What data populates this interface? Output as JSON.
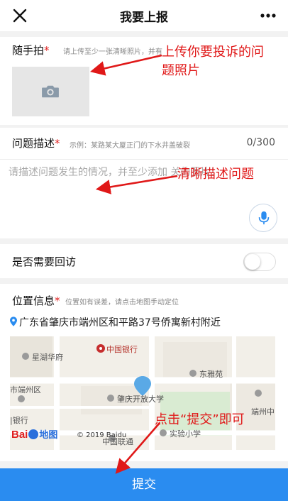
{
  "header": {
    "title": "我要上报",
    "close_icon": "close-icon",
    "more_icon": "more-icon"
  },
  "photo": {
    "label": "随手拍",
    "required_mark": "*",
    "hint": "请上传至少一张清晰照片，并有",
    "icon": "camera-icon"
  },
  "description": {
    "label": "问题描述",
    "required_mark": "*",
    "example": "示例：某路某大厦正门的下水井盖破裂",
    "counter": "0/300",
    "placeholder": "请描述问题发生的情况，并至少添加 关的图片！",
    "mic_icon": "microphone-icon"
  },
  "callback": {
    "label": "是否需要回访",
    "toggle_on": false
  },
  "location": {
    "label": "位置信息",
    "required_mark": "*",
    "hint": "位置如有误差，请点击地图手动定位",
    "address": "广东省肇庆市端州区和平路37号侨寓新村附近",
    "pin_icon": "location-pin-icon",
    "map_labels": {
      "boc": "中国银行",
      "xinghu": "星湖华府",
      "dongya": "东雅苑",
      "duanzhou_district": "市端州区",
      "zqu": "肇庆开放大学",
      "shiyan": "实验小学",
      "bank": "|银行",
      "unicom": "中国联通",
      "duanzhou_mid": "端州中",
      "baidu_text": "Bai",
      "baidu_map": "地图",
      "copyright": "© 2019 Baidu"
    }
  },
  "submit": {
    "label": "提交"
  },
  "annotations": {
    "photo": "上传你要投诉的问",
    "photo_line2": "题照片",
    "desc": "清晰描述问题",
    "submit": "点击“提交”即可"
  },
  "colors": {
    "accent": "#2a8cf0",
    "annotation": "#e01818",
    "required": "#e02020"
  }
}
